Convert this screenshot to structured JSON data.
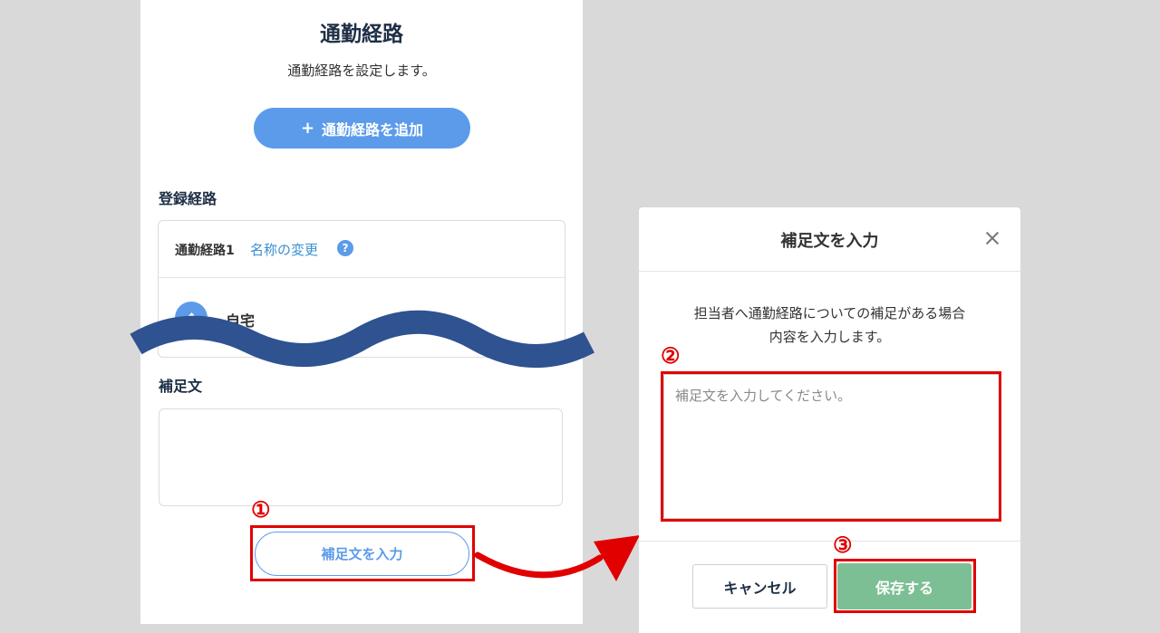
{
  "left_panel": {
    "title": "通勤経路",
    "description": "通勤経路を設定します。",
    "add_route_button": {
      "icon": "plus-icon",
      "plus_glyph": "+",
      "label": "通勤経路を追加"
    },
    "registered_routes_label": "登録経路",
    "route_card": {
      "route_name": "通勤経路1",
      "rename_link": "名称の変更",
      "help_glyph": "?",
      "start_point": "自宅"
    },
    "supplement_label": "補足文",
    "supplement_button": "補足文を入力"
  },
  "annotations": {
    "step1": "①",
    "step2": "②",
    "step3": "③",
    "highlight_color": "#e00000",
    "wave_color": "#2f5290"
  },
  "modal": {
    "title": "補足文を入力",
    "close_icon": "close-icon",
    "description_line1": "担当者へ通勤経路についての補足がある場合",
    "description_line2": "内容を入力します。",
    "textarea_placeholder": "補足文を入力してください。",
    "textarea_value": "",
    "cancel_button": "キャンセル",
    "save_button": "保存する"
  },
  "colors": {
    "primary_blue": "#5b9bea",
    "save_green": "#7dbf94",
    "heading_navy": "#1e2f46",
    "background_gray": "#d9d9d9"
  }
}
